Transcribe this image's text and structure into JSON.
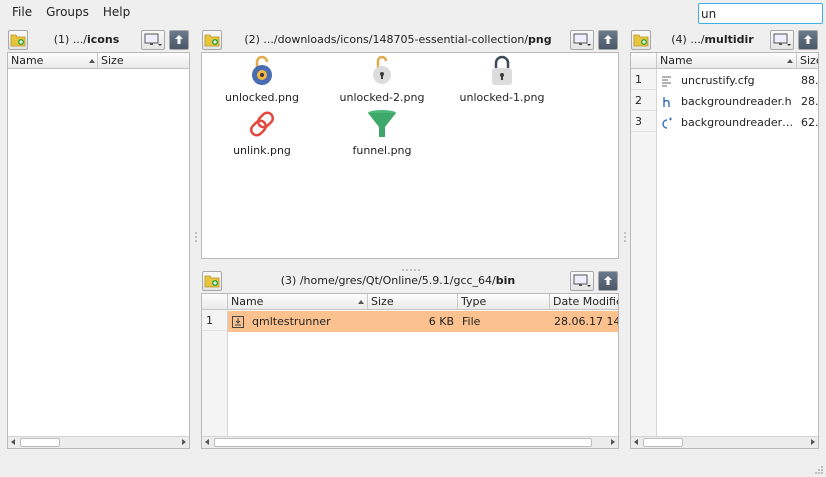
{
  "menu": [
    "File",
    "Groups",
    "Help"
  ],
  "search": {
    "value": "un"
  },
  "panel1": {
    "path_prefix": "(1) .../",
    "path_bold": "icons",
    "columns": [
      "Name",
      "Size"
    ]
  },
  "panel2": {
    "path_prefix": "(2) .../downloads/icons/148705-essential-collection/",
    "path_bold": "png",
    "items": [
      {
        "label": "unlocked.png",
        "icon": "unlocked-icon"
      },
      {
        "label": "unlocked-2.png",
        "icon": "unlocked-2-icon"
      },
      {
        "label": "unlocked-1.png",
        "icon": "unlocked-1-icon"
      },
      {
        "label": "unlink.png",
        "icon": "unlink-icon"
      },
      {
        "label": "funnel.png",
        "icon": "funnel-icon"
      }
    ]
  },
  "panel3": {
    "path_prefix": "(3) /home/gres/Qt/Online/5.9.1/gcc_64/",
    "path_bold": "bin",
    "columns": [
      "Name",
      "Size",
      "Type",
      "Date Modifie"
    ],
    "rows": [
      {
        "num": "1",
        "name": "qmltestrunner",
        "size": "6 KB",
        "type": "File",
        "date": "28.06.17 14"
      }
    ],
    "selected_color": "#fbc28f"
  },
  "panel4": {
    "path_prefix": "(4) .../",
    "path_bold": "multidir",
    "columns": [
      "Name",
      "Size"
    ],
    "rows": [
      {
        "num": "1",
        "name": "uncrustify.cfg",
        "size": "88.",
        "icon": "text-file-icon"
      },
      {
        "num": "2",
        "name": "backgroundreader.h",
        "size": "28.",
        "icon": "header-file-icon"
      },
      {
        "num": "3",
        "name": "backgroundreader…",
        "size": "62.",
        "icon": "cpp-file-icon"
      }
    ]
  }
}
